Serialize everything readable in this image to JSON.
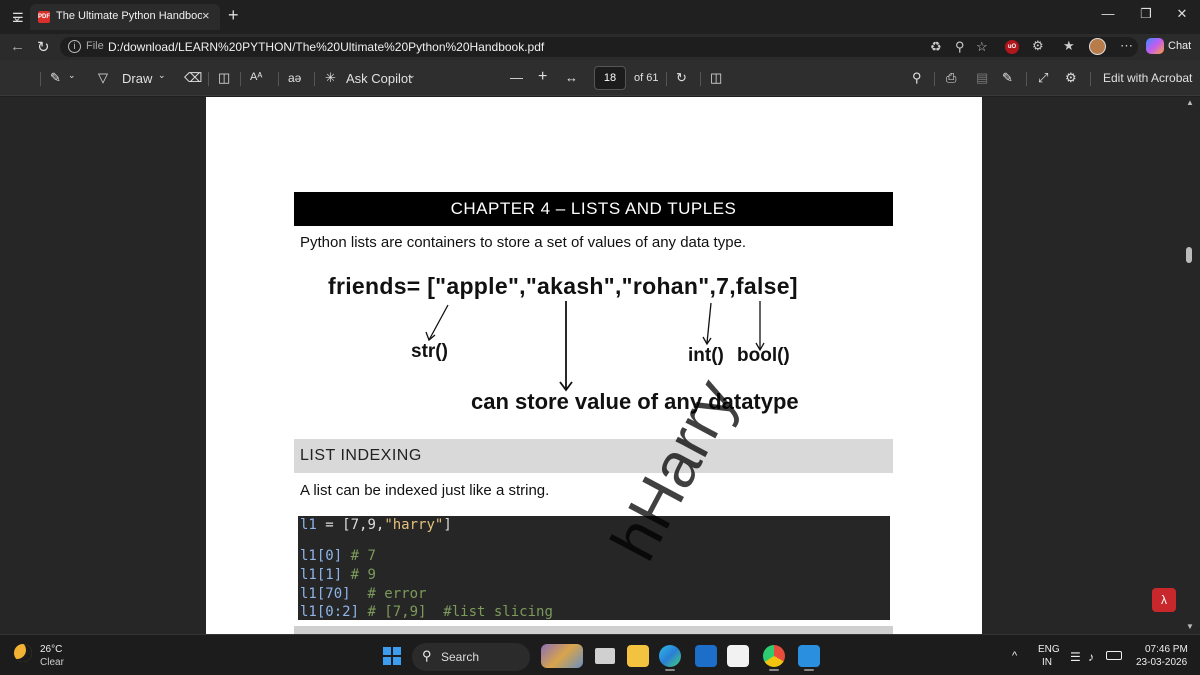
{
  "browser": {
    "tab_title": "The Ultimate Python Handbook.pd",
    "tab_close": "×",
    "new_tab": "+",
    "url_scheme": "File",
    "url_path": "D:/download/LEARN%20PYTHON/The%20Ultimate%20Python%20Handbook.pdf",
    "chat_label": "Chat"
  },
  "toolbar": {
    "draw_label": "Draw",
    "ask_copilot_label": "Ask Copilot",
    "page_number": "18",
    "page_total": "of 61",
    "edit_with_acrobat": "Edit with Acrobat",
    "text_size_glyph": "Aᴬ",
    "read_aloud_glyph": "aə"
  },
  "document": {
    "chapter_title": "CHAPTER 4 – LISTS AND TUPLES",
    "intro": "Python lists are containers to store a set of values of any data type.",
    "handwritten": {
      "friends_line": "friends= [\"apple\",\"akash\",\"rohan\",7,false]",
      "str_label": "str()",
      "int_label": "int()",
      "bool_label": "bool()",
      "any_datatype": "can store value of any datatype"
    },
    "section_title": "LIST INDEXING",
    "section_text": "A list can be indexed just like a string.",
    "code": {
      "line1_var": "l1",
      "line1_op": " = ",
      "line1_rest": "[7,9,",
      "line1_str": "\"harry\"",
      "line1_end": "]",
      "line2_code": "l1[0]",
      "line2_comment": " # 7",
      "line3_code": "l1[1]",
      "line3_comment": " # 9",
      "line4_code": "l1[70]",
      "line4_comment": "  # error",
      "line5_code": "l1[0:2]",
      "line5_comment": " # [7,9]  #list slicing"
    },
    "watermark": "hHarry"
  },
  "taskbar": {
    "temperature": "26°C",
    "condition": "Clear",
    "search_label": "Search",
    "language_top": "ENG",
    "language_bottom": "IN",
    "time": "07:46 PM",
    "date": "23-03-2026"
  },
  "colors": {
    "accent": "#3b9cf0",
    "pdf_red": "#d9302c",
    "chapter_bg": "#000000",
    "section_bg": "#d9d9d9",
    "code_bg": "#262626"
  }
}
